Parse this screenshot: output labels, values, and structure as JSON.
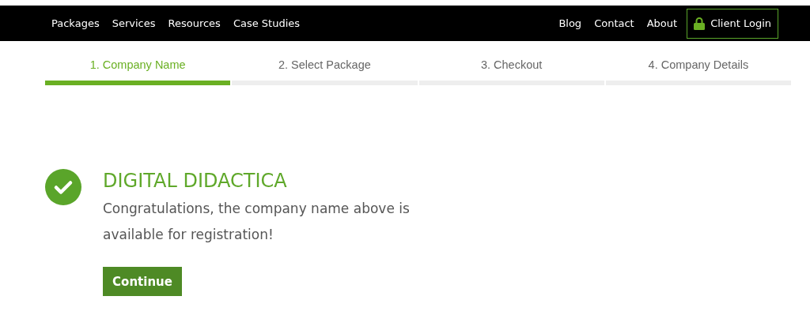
{
  "nav": {
    "left": [
      "Packages",
      "Services",
      "Resources",
      "Case Studies"
    ],
    "right": [
      "Blog",
      "Contact",
      "About"
    ],
    "login": "Client Login"
  },
  "steps": [
    {
      "label": "1. Company Name",
      "selected": true
    },
    {
      "label": "2. Select Package",
      "selected": false
    },
    {
      "label": "3. Checkout",
      "selected": false
    },
    {
      "label": "4. Company Details",
      "selected": false
    }
  ],
  "result": {
    "title": "DIGITAL DIDACTICA",
    "message": "Congratulations, the company name above is available for registration!",
    "button": "Continue"
  }
}
